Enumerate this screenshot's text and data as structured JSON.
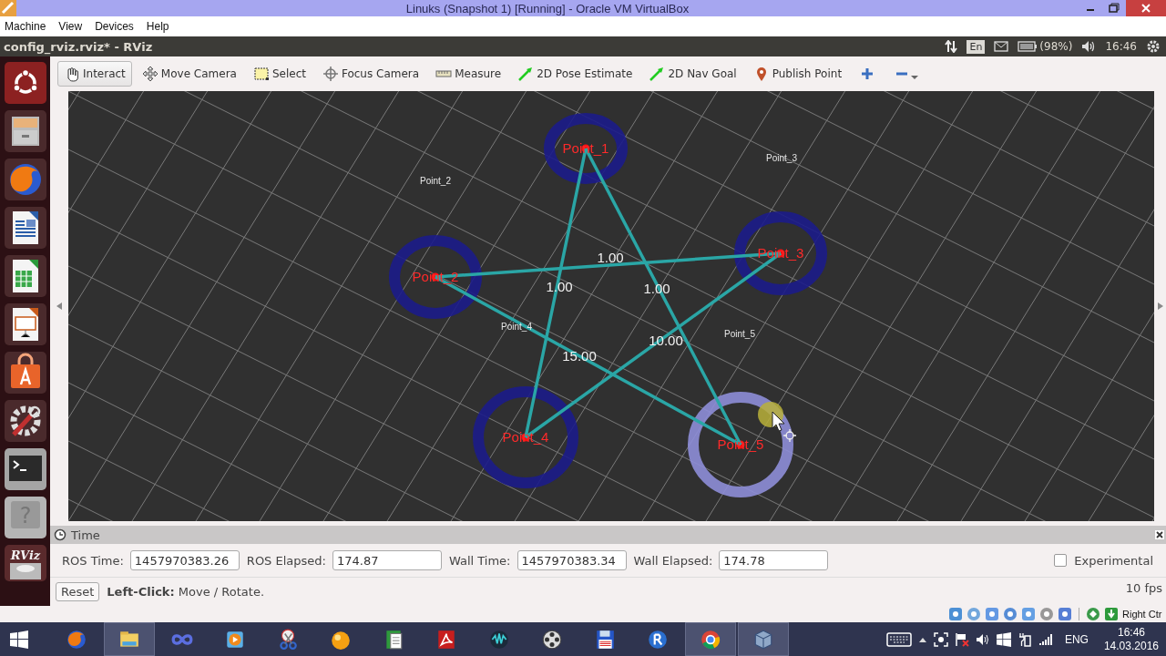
{
  "vbox_window": {
    "title": "Linuks (Snapshot 1) [Running] - Oracle VM VirtualBox",
    "menu": [
      "Machine",
      "View",
      "Devices",
      "Help"
    ],
    "host_key": "Right Ctr"
  },
  "top_panel": {
    "title": "config_rviz.rviz* - RViz",
    "keyboard": "En",
    "battery": "(98%)",
    "clock": "16:46"
  },
  "launcher": {
    "help_mark": "?",
    "rviz_label": "RViz"
  },
  "toolbar": {
    "tools": [
      {
        "label": "Interact",
        "selected": true
      },
      {
        "label": "Move Camera",
        "selected": false
      },
      {
        "label": "Select",
        "selected": false
      },
      {
        "label": "Focus Camera",
        "selected": false
      },
      {
        "label": "Measure",
        "selected": false
      },
      {
        "label": "2D Pose Estimate",
        "selected": false
      },
      {
        "label": "2D Nav Goal",
        "selected": false
      },
      {
        "label": "Publish Point",
        "selected": false
      }
    ]
  },
  "view": {
    "nodes": [
      {
        "label": "Point_1",
        "selected": false
      },
      {
        "label": "Point_2",
        "selected": false
      },
      {
        "label": "Point_3",
        "selected": false
      },
      {
        "label": "Point_4",
        "selected": false
      },
      {
        "label": "Point_5",
        "selected": true
      }
    ],
    "edge_labels": [
      "1.00",
      "1.00",
      "1.00",
      "10.00",
      "15.00"
    ],
    "name_labels": [
      "Point_2",
      "Point_3",
      "Point_4",
      "Point_5"
    ]
  },
  "time_panel": {
    "title": "Time",
    "fields": [
      {
        "label": "ROS Time:",
        "value": "1457970383.26"
      },
      {
        "label": "ROS Elapsed:",
        "value": "174.87"
      },
      {
        "label": "Wall Time:",
        "value": "1457970383.34"
      },
      {
        "label": "Wall Elapsed:",
        "value": "174.78"
      }
    ],
    "experimental": {
      "label": "Experimental",
      "checked": false
    }
  },
  "status": {
    "reset": "Reset",
    "hint": "**Left-Click:** Move / Rotate.",
    "fps": "10 fps"
  },
  "taskbar": {
    "apps": [
      {
        "selected": false
      },
      {
        "selected": true
      },
      {
        "selected": false
      },
      {
        "selected": false
      },
      {
        "selected": false
      },
      {
        "selected": false
      },
      {
        "selected": false
      },
      {
        "selected": false
      },
      {
        "selected": false
      },
      {
        "selected": false
      },
      {
        "selected": false
      },
      {
        "selected": false
      },
      {
        "selected": true
      },
      {
        "selected": true
      }
    ],
    "language": "ENG",
    "time": "16:46",
    "date": "14.03.2016"
  }
}
